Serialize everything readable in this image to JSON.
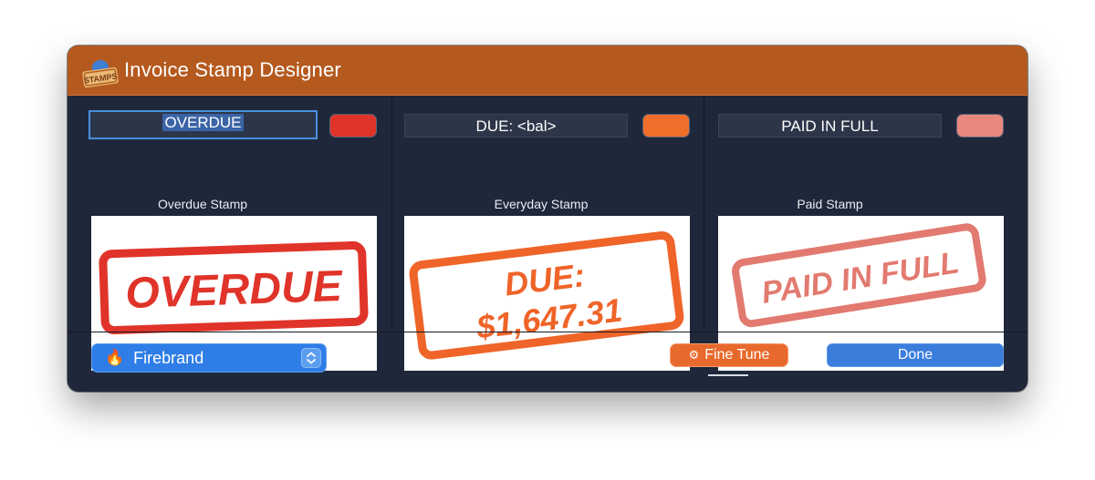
{
  "window": {
    "title": "Invoice Stamp Designer",
    "app_icon_text": "STAMPS",
    "accent_color": "#b55a1f"
  },
  "stamps": [
    {
      "field_value": "OVERDUE",
      "swatch_color": "#e0342a",
      "caption": "Overdue Stamp",
      "preview_lines": [
        "OVERDUE"
      ],
      "preview_color": "#e0342a"
    },
    {
      "field_value": "DUE: <bal>",
      "swatch_color": "#ef6e2a",
      "caption": "Everyday Stamp",
      "preview_lines": [
        "DUE:",
        "$1,647.31"
      ],
      "preview_color": "#ef6428"
    },
    {
      "field_value": "PAID IN FULL",
      "swatch_color": "#e8877e",
      "caption": "Paid Stamp",
      "preview_lines": [
        "PAID IN FULL"
      ],
      "preview_color": "#e27a70"
    }
  ],
  "footer": {
    "preset_icon": "flame-icon",
    "preset_label": "Firebrand",
    "fine_tune_label": "Fine Tune",
    "done_label": "Done"
  }
}
